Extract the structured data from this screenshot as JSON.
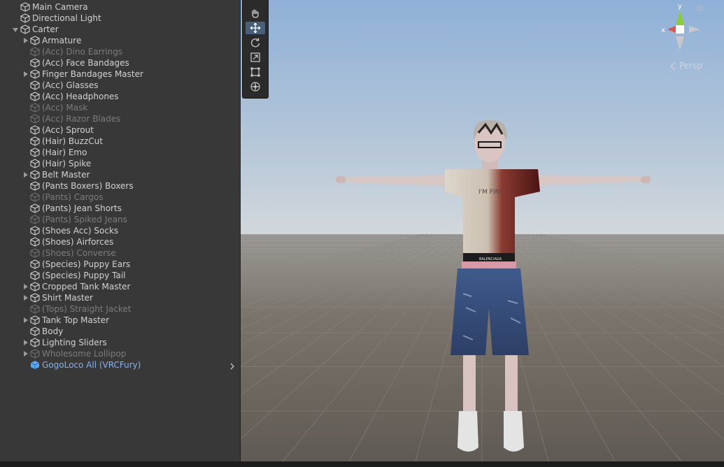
{
  "hierarchy": {
    "items": [
      {
        "label": "Main Camera",
        "depth": 0,
        "fold": "none",
        "state": "normal"
      },
      {
        "label": "Directional Light",
        "depth": 0,
        "fold": "none",
        "state": "normal"
      },
      {
        "label": "Carter",
        "depth": 0,
        "fold": "expanded",
        "state": "normal"
      },
      {
        "label": "Armature",
        "depth": 1,
        "fold": "collapsed",
        "state": "normal"
      },
      {
        "label": "(Acc) Dino Earrings",
        "depth": 1,
        "fold": "none",
        "state": "disabled"
      },
      {
        "label": "(Acc) Face Bandages",
        "depth": 1,
        "fold": "none",
        "state": "normal"
      },
      {
        "label": "Finger Bandages Master",
        "depth": 1,
        "fold": "collapsed",
        "state": "normal"
      },
      {
        "label": "(Acc) Glasses",
        "depth": 1,
        "fold": "none",
        "state": "normal"
      },
      {
        "label": "(Acc) Headphones",
        "depth": 1,
        "fold": "none",
        "state": "normal"
      },
      {
        "label": "(Acc) Mask",
        "depth": 1,
        "fold": "none",
        "state": "disabled"
      },
      {
        "label": "(Acc) Razor Blades",
        "depth": 1,
        "fold": "none",
        "state": "disabled"
      },
      {
        "label": "(Acc) Sprout",
        "depth": 1,
        "fold": "none",
        "state": "normal"
      },
      {
        "label": "(Hair) BuzzCut",
        "depth": 1,
        "fold": "none",
        "state": "normal"
      },
      {
        "label": "(Hair) Emo",
        "depth": 1,
        "fold": "none",
        "state": "normal"
      },
      {
        "label": "(Hair) Spike",
        "depth": 1,
        "fold": "none",
        "state": "normal"
      },
      {
        "label": "Belt Master",
        "depth": 1,
        "fold": "collapsed",
        "state": "normal"
      },
      {
        "label": "(Pants Boxers) Boxers",
        "depth": 1,
        "fold": "none",
        "state": "normal"
      },
      {
        "label": "(Pants) Cargos",
        "depth": 1,
        "fold": "none",
        "state": "disabled"
      },
      {
        "label": "(Pants) Jean Shorts",
        "depth": 1,
        "fold": "none",
        "state": "normal"
      },
      {
        "label": "(Pants) Spiked Jeans",
        "depth": 1,
        "fold": "none",
        "state": "disabled"
      },
      {
        "label": "(Shoes Acc) Socks",
        "depth": 1,
        "fold": "none",
        "state": "normal"
      },
      {
        "label": "(Shoes) Airforces",
        "depth": 1,
        "fold": "none",
        "state": "normal"
      },
      {
        "label": "(Shoes) Converse",
        "depth": 1,
        "fold": "none",
        "state": "disabled"
      },
      {
        "label": "(Species) Puppy Ears",
        "depth": 1,
        "fold": "none",
        "state": "normal"
      },
      {
        "label": "(Species) Puppy Tail",
        "depth": 1,
        "fold": "none",
        "state": "normal"
      },
      {
        "label": "Cropped Tank Master",
        "depth": 1,
        "fold": "collapsed",
        "state": "normal"
      },
      {
        "label": "Shirt Master",
        "depth": 1,
        "fold": "collapsed",
        "state": "normal"
      },
      {
        "label": "(Tops) Straight Jacket",
        "depth": 1,
        "fold": "none",
        "state": "disabled"
      },
      {
        "label": "Tank Top Master",
        "depth": 1,
        "fold": "collapsed",
        "state": "normal"
      },
      {
        "label": "Body",
        "depth": 1,
        "fold": "none",
        "state": "normal"
      },
      {
        "label": "Lighting Sliders",
        "depth": 1,
        "fold": "collapsed",
        "state": "normal"
      },
      {
        "label": "Wholesome Lollipop",
        "depth": 1,
        "fold": "collapsed",
        "state": "disabled"
      },
      {
        "label": "GogoLoco All (VRCFury)",
        "depth": 1,
        "fold": "none",
        "state": "prefab",
        "has_arrow": true
      }
    ]
  },
  "scene": {
    "tools": [
      {
        "name": "hand-tool",
        "active": false
      },
      {
        "name": "move-tool",
        "active": true
      },
      {
        "name": "rotate-tool",
        "active": false
      },
      {
        "name": "scale-tool",
        "active": false
      },
      {
        "name": "rect-tool",
        "active": false
      },
      {
        "name": "transform-tool",
        "active": false
      }
    ],
    "gizmo": {
      "y_label": "y",
      "x_label": "x",
      "projection_label": "Persp"
    },
    "character_shirt_text": "I'M FINE",
    "character_belt_text": "BALENCIAGA"
  },
  "colors": {
    "panel_bg": "#383838",
    "text": "#d2d2d2",
    "text_disabled": "#7c7c7c",
    "text_prefab": "#80b4f0",
    "tool_active": "#46607c",
    "gizmo_y": "#8ccc3a",
    "gizmo_x": "#e0514a"
  }
}
